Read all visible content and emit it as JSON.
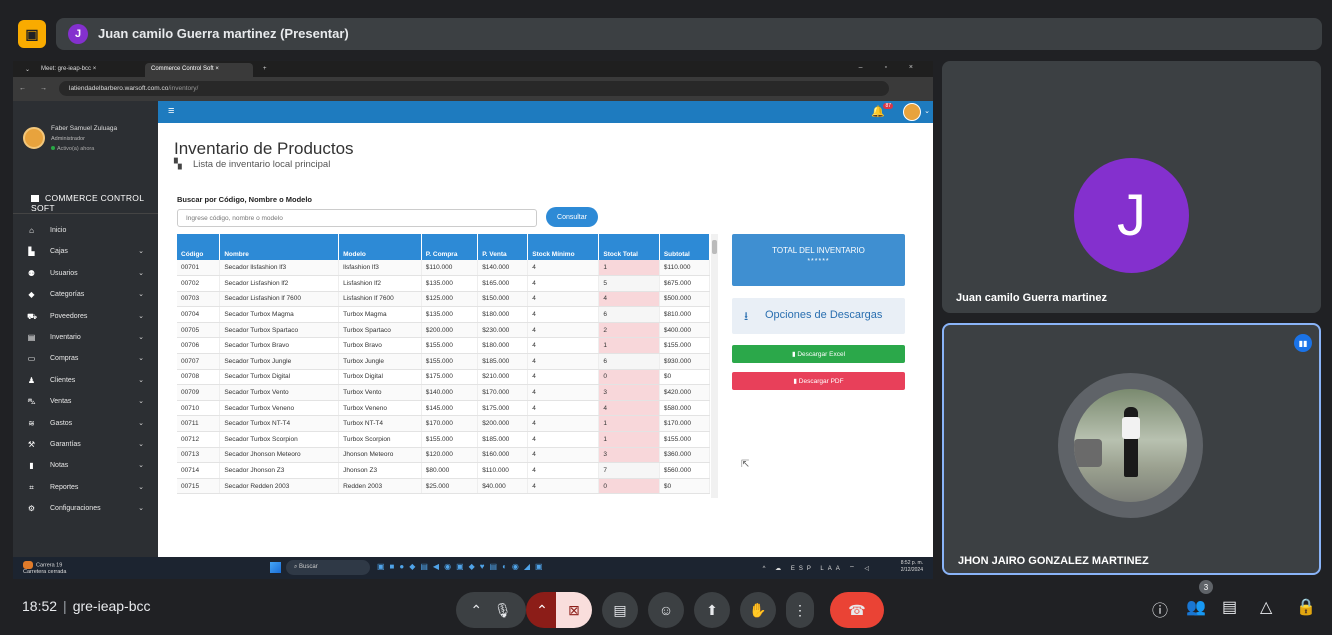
{
  "meet": {
    "presenter_initial": "J",
    "presenter_title": "Juan camilo Guerra martinez (Presentar)",
    "time": "18:52",
    "meeting_code": "gre-ieap-bcc",
    "people_count": "3"
  },
  "browser": {
    "tabs": [
      "Meet: gre-ieap-bcc",
      "Commerce Control Soft"
    ],
    "url_host": "latiendadelbarbero.warsoft.com.co",
    "url_path": "/inventory/"
  },
  "app": {
    "brand": "COMMERCE CONTROL SOFT",
    "notification_count": "87",
    "user": {
      "name": "Faber Samuel Zuluaga",
      "role": "Administrador",
      "status": "Activo(a) ahora"
    },
    "menu": [
      {
        "label": "Inicio",
        "icon": "home-icon",
        "chevron": false
      },
      {
        "label": "Cajas",
        "icon": "cash-register-icon",
        "chevron": true
      },
      {
        "label": "Usuarios",
        "icon": "users-icon",
        "chevron": true
      },
      {
        "label": "Categorías",
        "icon": "tag-icon",
        "chevron": true
      },
      {
        "label": "Poveedores",
        "icon": "truck-icon",
        "chevron": true
      },
      {
        "label": "Inventario",
        "icon": "archive-icon",
        "chevron": true
      },
      {
        "label": "Compras",
        "icon": "credit-card-icon",
        "chevron": true
      },
      {
        "label": "Clientes",
        "icon": "person-icon",
        "chevron": true
      },
      {
        "label": "Ventas",
        "icon": "cart-icon",
        "chevron": true
      },
      {
        "label": "Gastos",
        "icon": "coins-icon",
        "chevron": true
      },
      {
        "label": "Garantías",
        "icon": "wrench-icon",
        "chevron": true
      },
      {
        "label": "Notas",
        "icon": "note-icon",
        "chevron": true
      },
      {
        "label": "Reportes",
        "icon": "chart-icon",
        "chevron": true
      },
      {
        "label": "Configuraciones",
        "icon": "cogs-icon",
        "chevron": true
      }
    ],
    "page_title": "Inventario de Productos",
    "page_subtitle": "Lista de inventario local principal",
    "search_label": "Buscar por Código, Nombre o Modelo",
    "search_placeholder": "Ingrese código, nombre o modelo",
    "consultar": "Consultar",
    "table": {
      "headers": [
        "Código",
        "Nombre",
        "Modelo",
        "P. Compra",
        "P. Venta",
        "Stock Mínimo",
        "Stock Total",
        "Subtotal"
      ],
      "rows": [
        [
          "00701",
          "Secador llsfashion lf3",
          "llsfashion lf3",
          "$110.000",
          "$140.000",
          "4",
          "1",
          "$110.000"
        ],
        [
          "00702",
          "Secador Lisfashion lf2",
          "Lisfashion lf2",
          "$135.000",
          "$165.000",
          "4",
          "5",
          "$675.000"
        ],
        [
          "00703",
          "Secador Lisfashion lf 7600",
          "Lisfashion lf 7600",
          "$125.000",
          "$150.000",
          "4",
          "4",
          "$500.000"
        ],
        [
          "00704",
          "Secador Turbox Magma",
          "Turbox Magma",
          "$135.000",
          "$180.000",
          "4",
          "6",
          "$810.000"
        ],
        [
          "00705",
          "Secador Turbox Spartaco",
          "Turbox Spartaco",
          "$200.000",
          "$230.000",
          "4",
          "2",
          "$400.000"
        ],
        [
          "00706",
          "Secador Turbox Bravo",
          "Turbox Bravo",
          "$155.000",
          "$180.000",
          "4",
          "1",
          "$155.000"
        ],
        [
          "00707",
          "Secador Turbox Jungle",
          "Turbox Jungle",
          "$155.000",
          "$185.000",
          "4",
          "6",
          "$930.000"
        ],
        [
          "00708",
          "Secador Turbox Digital",
          "Turbox Digital",
          "$175.000",
          "$210.000",
          "4",
          "0",
          "$0"
        ],
        [
          "00709",
          "Secador Turbox Vento",
          "Turbox Vento",
          "$140.000",
          "$170.000",
          "4",
          "3",
          "$420.000"
        ],
        [
          "00710",
          "Secador Turbox Veneno",
          "Turbox Veneno",
          "$145.000",
          "$175.000",
          "4",
          "4",
          "$580.000"
        ],
        [
          "00711",
          "Secador Turbox NT-T4",
          "Turbox NT-T4",
          "$170.000",
          "$200.000",
          "4",
          "1",
          "$170.000"
        ],
        [
          "00712",
          "Secador Turbox Scorpion",
          "Turbox Scorpion",
          "$155.000",
          "$185.000",
          "4",
          "1",
          "$155.000"
        ],
        [
          "00713",
          "Secador Jhonson Meteoro",
          "Jhonson Meteoro",
          "$120.000",
          "$160.000",
          "4",
          "3",
          "$360.000"
        ],
        [
          "00714",
          "Secador Jhonson Z3",
          "Jhonson Z3",
          "$80.000",
          "$110.000",
          "4",
          "7",
          "$560.000"
        ],
        [
          "00715",
          "Secador Redden 2003",
          "Redden 2003",
          "$25.000",
          "$40.000",
          "4",
          "0",
          "$0"
        ]
      ]
    },
    "total_title": "TOTAL DEL INVENTARIO",
    "total_value": "******",
    "downloads_title": "Opciones de Descargas",
    "excel_label": "Descargar Excel",
    "pdf_label": "Descargar PDF"
  },
  "taskbar": {
    "weather_temp": "Carrera 19",
    "weather_desc": "Carretera cerrada",
    "search": "Buscar",
    "lang": "ESP LAA",
    "time": "8:52 p. m.",
    "date": "2/12/2024"
  },
  "participants": [
    {
      "initial": "J",
      "name": "Juan camilo Guerra martinez"
    },
    {
      "name": "JHON JAIRO GONZALEZ MARTINEZ"
    }
  ],
  "colors": {
    "meet_bg": "#202124",
    "tile_bg": "#3c4043",
    "avatar_purple": "#8430ce",
    "app_blue": "#1e7bbf",
    "stock_low": "#f8d7da",
    "end_call_red": "#ea4335"
  }
}
